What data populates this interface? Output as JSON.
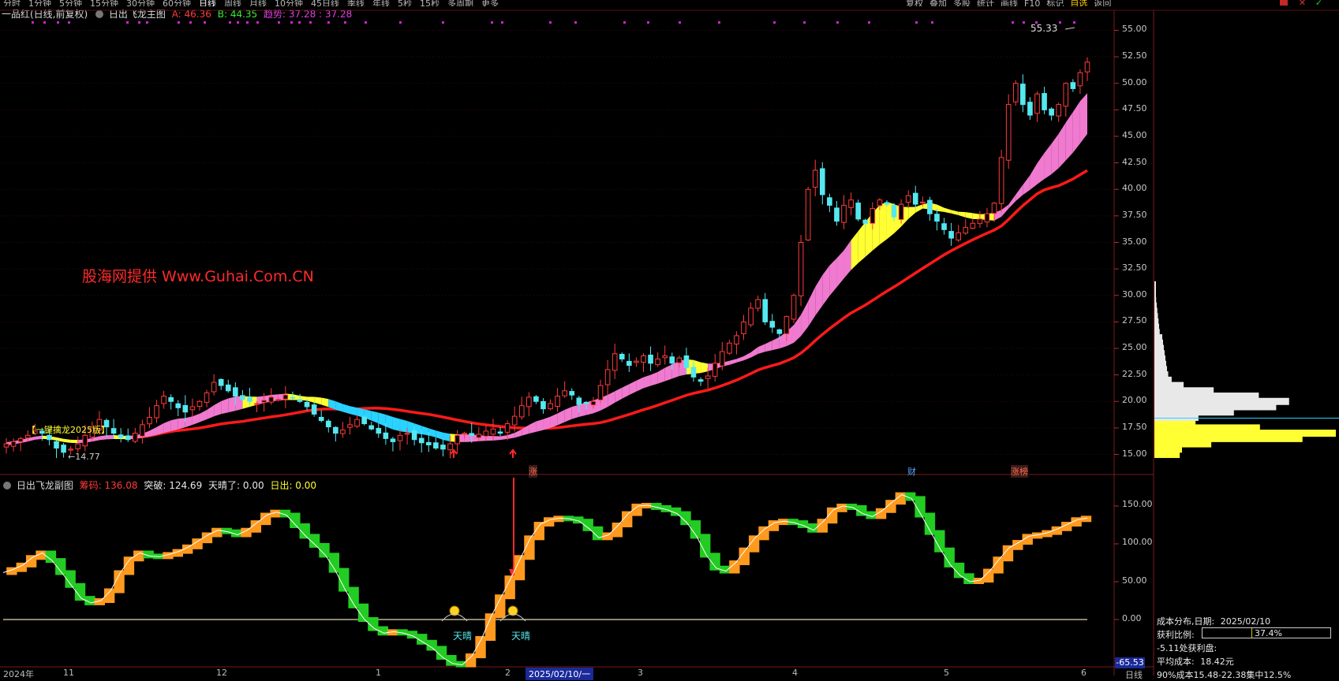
{
  "top_toolbar": {
    "items": [
      "分时",
      "1分钟",
      "5分钟",
      "15分钟",
      "30分钟",
      "60分钟",
      "日线",
      "周线",
      "月线",
      "10分钟",
      "45日线",
      "季线",
      "年线",
      "5秒",
      "15秒",
      "多周期",
      "更多"
    ],
    "right_items": [
      "复权",
      "叠加",
      "多股",
      "统计",
      "画线",
      "F10",
      "标记",
      "自选",
      "返回"
    ]
  },
  "main_header": {
    "stock_name": "一品红(日线,前复权)",
    "indicator_name": "日出飞龙主图",
    "a_label": "A: 46.36",
    "b_label": "B: 44.35",
    "trend_label": "趋势: 37.28 : 37.28"
  },
  "watermark": "股海网提供 Www.Guhai.Com.CN",
  "yellow_tag": "【一键擒龙2025版】",
  "low_price_label": "←14.77",
  "high_price_label": "55.33",
  "events": [
    {
      "text": "涨",
      "color": "#ff6a4a"
    },
    {
      "text": "财",
      "color": "#4fa6ff"
    },
    {
      "text": "涨榜",
      "color": "#ff6a4a"
    }
  ],
  "main_yaxis": [
    "55.00",
    "52.50",
    "50.00",
    "47.50",
    "45.00",
    "42.50",
    "40.00",
    "37.50",
    "35.00",
    "32.50",
    "30.00",
    "27.50",
    "25.00",
    "22.50",
    "20.00",
    "17.50",
    "15.00"
  ],
  "sub_header": {
    "name": "日出飞龙副图",
    "chip": "筹码: 136.08",
    "breakout": "突破: 124.69",
    "sunny": "天晴了: 0.00",
    "sunrise": "日出: 0.00"
  },
  "sub_yaxis": [
    "150.00",
    "100.00",
    "50.00",
    "0.00"
  ],
  "sub_min_badge": "-65.53",
  "sun_labels": [
    "天晴",
    "天晴"
  ],
  "date_axis": [
    "2024年",
    "11",
    "12",
    "1",
    "2",
    "2025/02/10/一",
    "3",
    "4",
    "5",
    "6"
  ],
  "cost_panel": {
    "title": "成本分布,日期:",
    "date": "2025/02/10",
    "profit_ratio_label": "获利比例:",
    "profit_ratio_value": "37.4%",
    "profit_fraction": 0.374,
    "profit_at_label": "-5.11处获利盘:",
    "avg_cost_label": "平均成本:",
    "avg_cost_value": "18.42元",
    "concentration": "90%成本15.48-22.38集中12.5%"
  },
  "corner_labels": {
    "daily": "日线"
  },
  "colors": {
    "up": "#ff3b3b",
    "down": "#54e8f0",
    "ma_red": "#ff1a1a",
    "band_pink": "#f07ad0",
    "band_yellow": "#ffff33",
    "band_cyan": "#2ad2ff",
    "green": "#22cc22",
    "orange": "#ff9a1e",
    "magenta": "#d020d0"
  },
  "chart_data": {
    "type": "candlestick",
    "dates_range": [
      "2024-10",
      "2025-06"
    ],
    "ylim": [
      14,
      56
    ],
    "closes": [
      16.0,
      16.2,
      16.5,
      16.8,
      17.2,
      17.0,
      16.4,
      15.6,
      15.2,
      15.5,
      16.0,
      16.8,
      17.5,
      18.3,
      17.6,
      17.0,
      16.6,
      16.4,
      17.0,
      17.8,
      18.5,
      19.6,
      20.5,
      20.0,
      19.4,
      19.0,
      19.5,
      20.0,
      20.8,
      21.8,
      21.5,
      21.0,
      20.5,
      20.2,
      20.0,
      19.8,
      20.1,
      20.4,
      20.2,
      20.6,
      20.3,
      20.0,
      19.5,
      18.8,
      18.2,
      17.6,
      17.0,
      17.3,
      17.8,
      18.3,
      17.9,
      17.4,
      17.0,
      16.5,
      16.2,
      16.8,
      17.0,
      16.4,
      16.1,
      15.9,
      15.6,
      15.5,
      16.0,
      16.8,
      17.0,
      16.8,
      16.9,
      17.2,
      17.4,
      17.0,
      17.9,
      18.6,
      19.6,
      20.4,
      20.0,
      19.3,
      19.8,
      20.5,
      21.0,
      20.6,
      19.7,
      19.8,
      20.0,
      21.5,
      23.0,
      24.5,
      24.0,
      23.4,
      23.8,
      24.3,
      23.6,
      24.0,
      24.3,
      23.6,
      24.1,
      23.2,
      22.3,
      21.9,
      22.4,
      23.6,
      24.7,
      25.5,
      26.2,
      27.5,
      28.8,
      29.6,
      27.5,
      27.0,
      26.4,
      28.0,
      30.0,
      35.0,
      40.0,
      41.8,
      39.5,
      38.5,
      37.0,
      38.5,
      39.0,
      37.2,
      36.8,
      38.2,
      39.0,
      38.6,
      37.4,
      38.6,
      39.4,
      38.6,
      38.8,
      37.7,
      37.0,
      36.2,
      35.4,
      35.9,
      36.4,
      36.8,
      37.2,
      37.7,
      38.7,
      43.0,
      48.0,
      50.0,
      48.0,
      47.0,
      49.0,
      47.5,
      47.0,
      48.0,
      50.0,
      49.5,
      51.0,
      52.0
    ]
  }
}
